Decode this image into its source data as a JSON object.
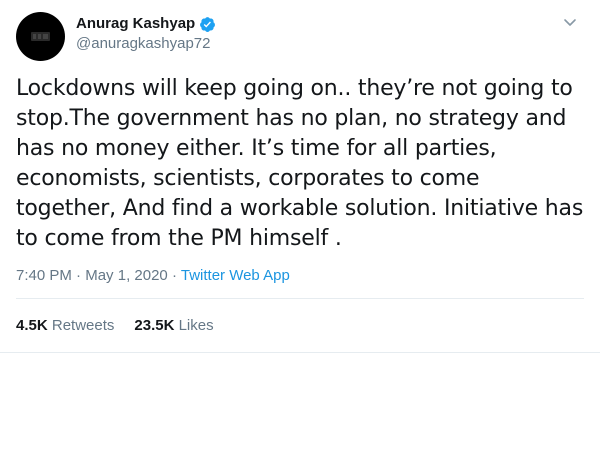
{
  "tweet": {
    "author": {
      "display_name": "Anurag Kashyap",
      "handle": "@anuragkashyap72",
      "verified": true
    },
    "text": "Lockdowns will keep going on.. they’re not going to stop.The government has no plan, no strategy and has no money either. It’s time for all parties, economists, scientists, corporates to come together, And find a workable solution. Initiative has to come from the PM himself .",
    "time": "7:40 PM",
    "separator": "·",
    "date": "May 1, 2020",
    "source": "Twitter Web App",
    "stats": {
      "retweets_count": "4.5K",
      "retweets_label": "Retweets",
      "likes_count": "23.5K",
      "likes_label": "Likes"
    }
  },
  "colors": {
    "verified": "#1da1f2",
    "link": "#1b95e0",
    "secondary_text": "#657786",
    "divider": "#e6ecf0"
  },
  "icons": {
    "verified": "verified-badge-icon",
    "menu": "chevron-down-icon"
  }
}
